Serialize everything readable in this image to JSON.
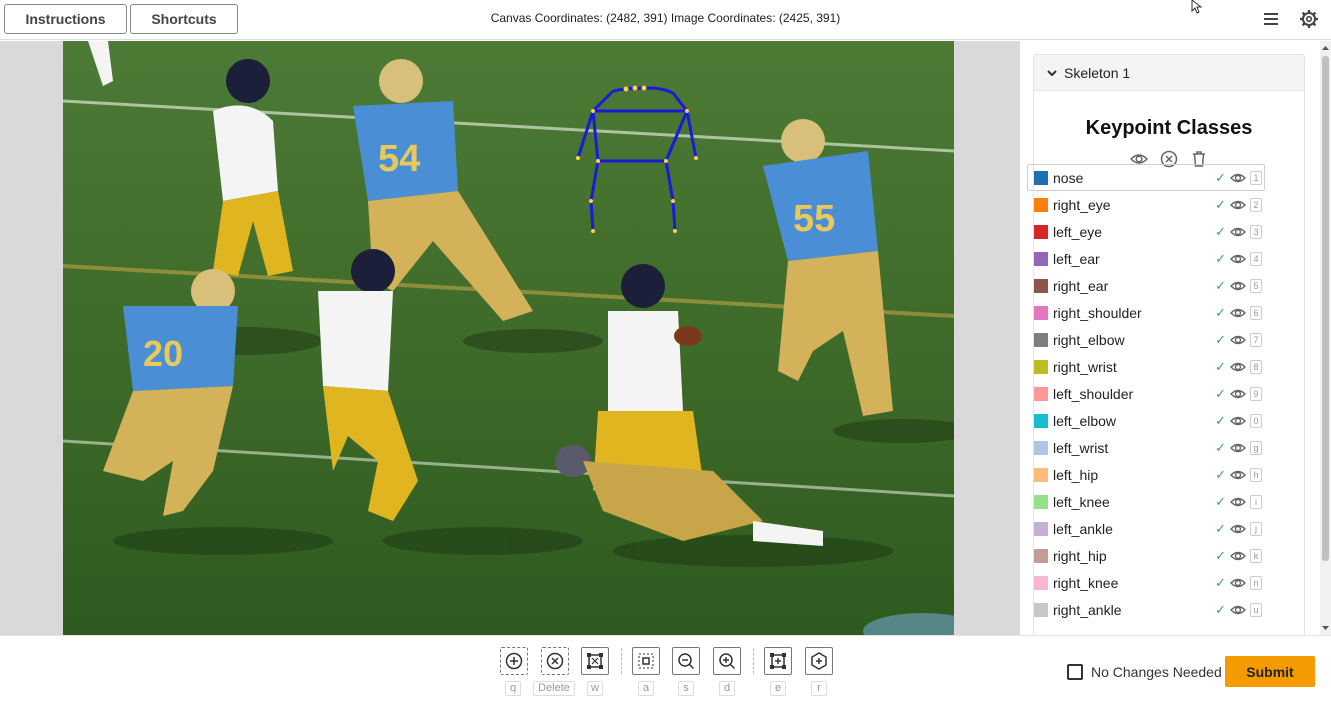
{
  "header": {
    "instructions_label": "Instructions",
    "shortcuts_label": "Shortcuts",
    "coordinates_text": "Canvas Coordinates: (2482, 391) Image Coordinates: (2425, 391)"
  },
  "panel": {
    "skeleton_label": "Skeleton 1",
    "title": "Keypoint Classes",
    "keypoints": [
      {
        "name": "nose",
        "key": "1",
        "color": "#1f6fb4"
      },
      {
        "name": "right_eye",
        "key": "2",
        "color": "#ff7f0e"
      },
      {
        "name": "left_eye",
        "key": "3",
        "color": "#d62728"
      },
      {
        "name": "left_ear",
        "key": "4",
        "color": "#9467bd"
      },
      {
        "name": "right_ear",
        "key": "5",
        "color": "#8c564b"
      },
      {
        "name": "right_shoulder",
        "key": "6",
        "color": "#e377c2"
      },
      {
        "name": "right_elbow",
        "key": "7",
        "color": "#7f7f7f"
      },
      {
        "name": "right_wrist",
        "key": "8",
        "color": "#bcbd22"
      },
      {
        "name": "left_shoulder",
        "key": "9",
        "color": "#ff9896"
      },
      {
        "name": "left_elbow",
        "key": "0",
        "color": "#17becf"
      },
      {
        "name": "left_wrist",
        "key": "g",
        "color": "#aec7e8"
      },
      {
        "name": "left_hip",
        "key": "h",
        "color": "#ffbb78"
      },
      {
        "name": "left_knee",
        "key": "i",
        "color": "#98df8a"
      },
      {
        "name": "left_ankle",
        "key": "j",
        "color": "#c5b0d5"
      },
      {
        "name": "right_hip",
        "key": "k",
        "color": "#c49c94"
      },
      {
        "name": "right_knee",
        "key": "n",
        "color": "#f7b6d2"
      },
      {
        "name": "right_ankle",
        "key": "u",
        "color": "#c7c7c7"
      }
    ]
  },
  "toolbar": {
    "keys": {
      "add": "q",
      "delete": "Delete",
      "bbox": "w",
      "fit": "a",
      "zoom_out": "s",
      "zoom_in": "d",
      "edit": "e",
      "reset": "r"
    },
    "no_changes_label": "No Changes Needed",
    "submit_label": "Submit"
  },
  "colors": {
    "submit": "#f59a00",
    "skeleton": "#1a1ad8",
    "field": "#3f6b2a"
  }
}
